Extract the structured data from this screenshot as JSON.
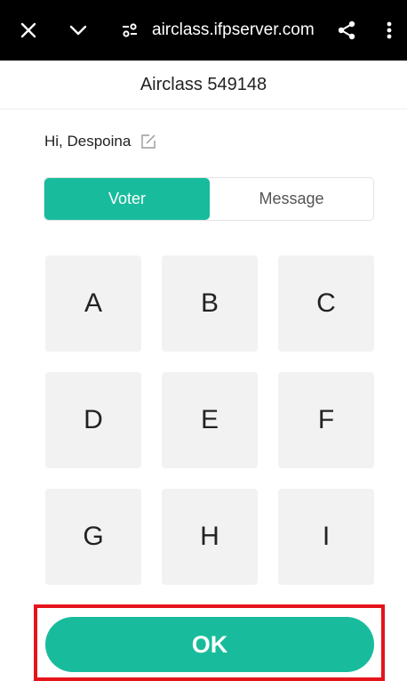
{
  "browser": {
    "url": "airclass.ifpserver.com",
    "icons": [
      "close-icon",
      "chevron-down-icon",
      "site-settings-icon",
      "share-icon",
      "more-vert-icon"
    ]
  },
  "header": {
    "title": "Airclass 549148"
  },
  "greeting": {
    "text": "Hi, Despoina",
    "edit_icon": "edit-icon"
  },
  "tabs": [
    {
      "label": "Voter",
      "active": true
    },
    {
      "label": "Message",
      "active": false
    }
  ],
  "choices": [
    "A",
    "B",
    "C",
    "D",
    "E",
    "F",
    "G",
    "H",
    "I"
  ],
  "ok_button": {
    "label": "OK"
  },
  "colors": {
    "accent": "#18bc9c",
    "highlight": "#e5141b",
    "tile": "#f2f2f2"
  }
}
